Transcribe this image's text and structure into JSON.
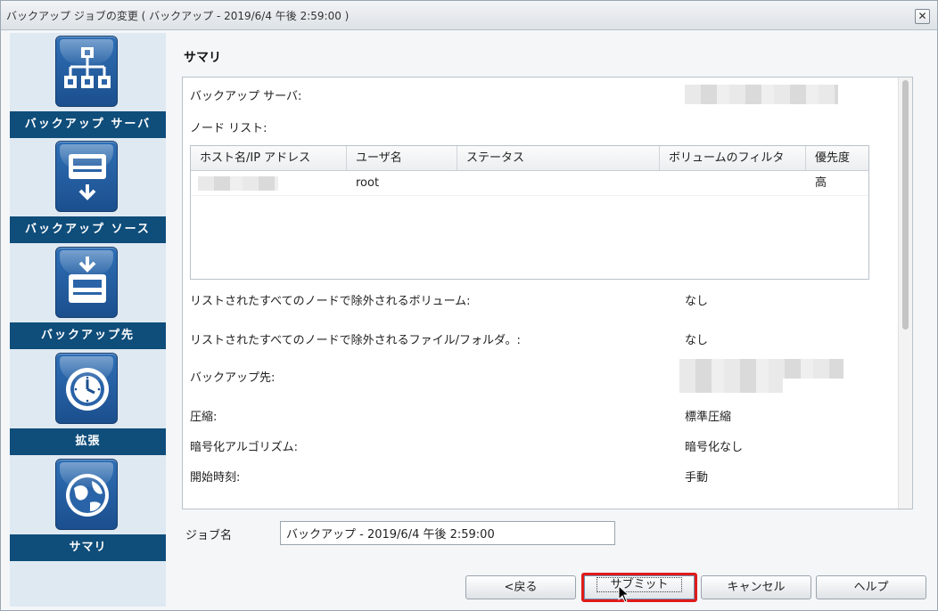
{
  "window": {
    "title": "バックアップ ジョブの変更 ( バックアップ - 2019/6/4 午後 2:59:00 )",
    "close_glyph": "✕"
  },
  "sidebar": {
    "steps": [
      {
        "label": "バックアップ サーバ",
        "icon": "server-tree-icon"
      },
      {
        "label": "バックアップ ソース",
        "icon": "disk-source-icon"
      },
      {
        "label": "バックアップ先",
        "icon": "disk-destination-icon"
      },
      {
        "label": "拡張",
        "icon": "clock-icon"
      },
      {
        "label": "サマリ",
        "icon": "globe-icon"
      }
    ]
  },
  "main": {
    "section_title": "サマリ",
    "summary": {
      "backup_server_label": "バックアップ サーバ:",
      "node_list_label": "ノード リスト:",
      "node_table": {
        "columns": [
          "ホスト名/IP アドレス",
          "ユーザ名",
          "ステータス",
          "ボリュームのフィルタ",
          "優先度"
        ],
        "rows": [
          {
            "host": "",
            "user": "root",
            "status": "",
            "volume_filter": "",
            "priority": "高"
          }
        ]
      },
      "excluded_volumes_label": "リストされたすべてのノードで除外されるボリューム:",
      "excluded_volumes_value": "なし",
      "excluded_files_label": "リストされたすべてのノードで除外されるファイル/フォルダ。:",
      "excluded_files_value": "なし",
      "destination_label": "バックアップ先:",
      "compression_label": "圧縮:",
      "compression_value": "標準圧縮",
      "encryption_label": "暗号化アルゴリズム:",
      "encryption_value": "暗号化なし",
      "start_time_label": "開始時刻:",
      "start_time_value": "手動"
    },
    "job_name": {
      "label": "ジョブ名",
      "value": "バックアップ - 2019/6/4 午後 2:59:00"
    }
  },
  "buttons": {
    "back": "<戻る",
    "submit": "サブミット",
    "cancel": "キャンセル",
    "help": "ヘルプ"
  },
  "colors": {
    "sidebar_label_bg": "#0f4d7a",
    "sidebar_bg": "#dfe9f2",
    "focus_highlight": "#e01b1b"
  }
}
